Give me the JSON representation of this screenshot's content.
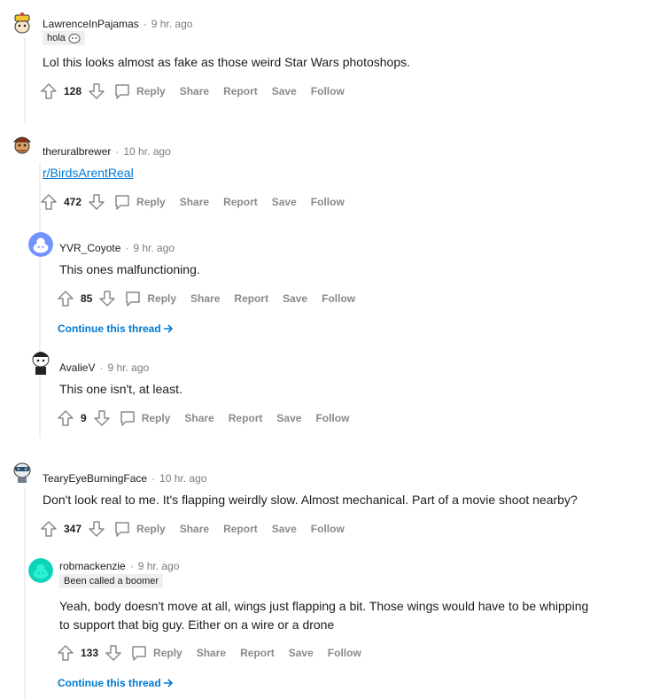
{
  "colors": {
    "link": "#0079d3",
    "muted": "#878a8c",
    "thread_line": "#edeff1"
  },
  "actions": {
    "reply": "Reply",
    "share": "Share",
    "report": "Report",
    "save": "Save",
    "follow": "Follow"
  },
  "continue_label": "Continue this thread",
  "comments": [
    {
      "user": "LawrenceInPajamas",
      "sep": "·",
      "time": "9 hr. ago",
      "flair": "hola",
      "body": "Lol this looks almost as fake as those weird Star Wars photoshops.",
      "score": "128"
    },
    {
      "user": "theruralbrewer",
      "sep": "·",
      "time": "10 hr. ago",
      "body_link": "r/BirdsArentReal",
      "score": "472"
    },
    {
      "user": "YVR_Coyote",
      "sep": "·",
      "time": "9 hr. ago",
      "body": "This ones malfunctioning.",
      "score": "85"
    },
    {
      "user": "AvalieV",
      "sep": "·",
      "time": "9 hr. ago",
      "body": "This one isn't, at least.",
      "score": "9"
    },
    {
      "user": "TearyEyeBurningFace",
      "sep": "·",
      "time": "10 hr. ago",
      "body": "Don't look real to me. It's flapping weirdly slow. Almost mechanical. Part of a movie shoot nearby?",
      "score": "347"
    },
    {
      "user": "robmackenzie",
      "sep": "·",
      "time": "9 hr. ago",
      "flair": "Been called a boomer",
      "body_lines": [
        "Yeah, body doesn't move at all, wings just flapping a bit. Those wings would have to be whipping",
        "to support that big guy. Either on a wire or a drone"
      ],
      "score": "133"
    }
  ]
}
